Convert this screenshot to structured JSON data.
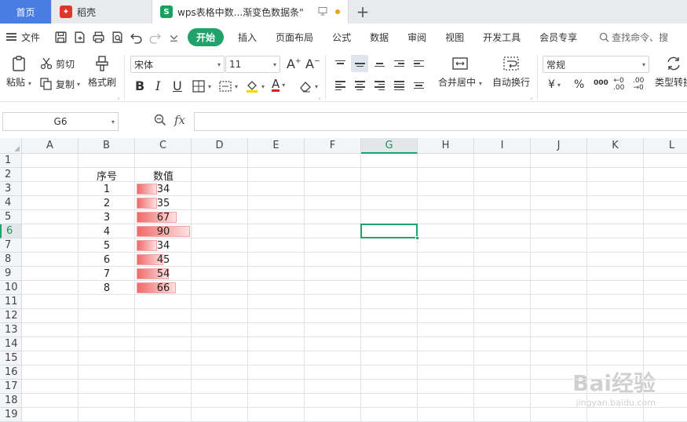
{
  "tabs": {
    "home": "首页",
    "daoke": "稻壳",
    "doc": "wps表格中数...渐变色数据条\""
  },
  "menu": {
    "file": "文件",
    "items": [
      "开始",
      "插入",
      "页面布局",
      "公式",
      "数据",
      "审阅",
      "视图",
      "开发工具",
      "会员专享"
    ],
    "search": "查找命令、搜"
  },
  "ribbon": {
    "paste": "粘贴",
    "cut": "剪切",
    "copy": "复制",
    "format_painter": "格式刷",
    "font_name": "宋体",
    "font_size": "11",
    "merge_center": "合并居中",
    "wrap_text": "自动换行",
    "number_format": "常规",
    "type_convert": "类型转换"
  },
  "formula_bar": {
    "name_box": "G6",
    "fx": "fx",
    "value": ""
  },
  "sheet": {
    "columns": [
      "A",
      "B",
      "C",
      "D",
      "E",
      "F",
      "G",
      "H",
      "I",
      "J",
      "K",
      "L"
    ],
    "rows": [
      "1",
      "2",
      "3",
      "4",
      "5",
      "6",
      "7",
      "8",
      "9",
      "10",
      "11",
      "12",
      "13",
      "14",
      "15",
      "16",
      "17",
      "18",
      "19"
    ],
    "selected_cell": "G6",
    "headers": {
      "b2": "序号",
      "c2": "数值"
    },
    "data": [
      {
        "seq": "1",
        "value": "34"
      },
      {
        "seq": "2",
        "value": "35"
      },
      {
        "seq": "3",
        "value": "67"
      },
      {
        "seq": "4",
        "value": "90"
      },
      {
        "seq": "5",
        "value": "34"
      },
      {
        "seq": "6",
        "value": "45"
      },
      {
        "seq": "7",
        "value": "54"
      },
      {
        "seq": "8",
        "value": "66"
      }
    ],
    "databar_max": 90,
    "databar_gradient": [
      "#f06a6a",
      "#fde1e1"
    ]
  },
  "watermark": {
    "brand": "Bai经验",
    "url": "jingyan.baidu.com"
  },
  "colors": {
    "accent": "#1fa36b",
    "home_tab": "#4a7de2"
  }
}
